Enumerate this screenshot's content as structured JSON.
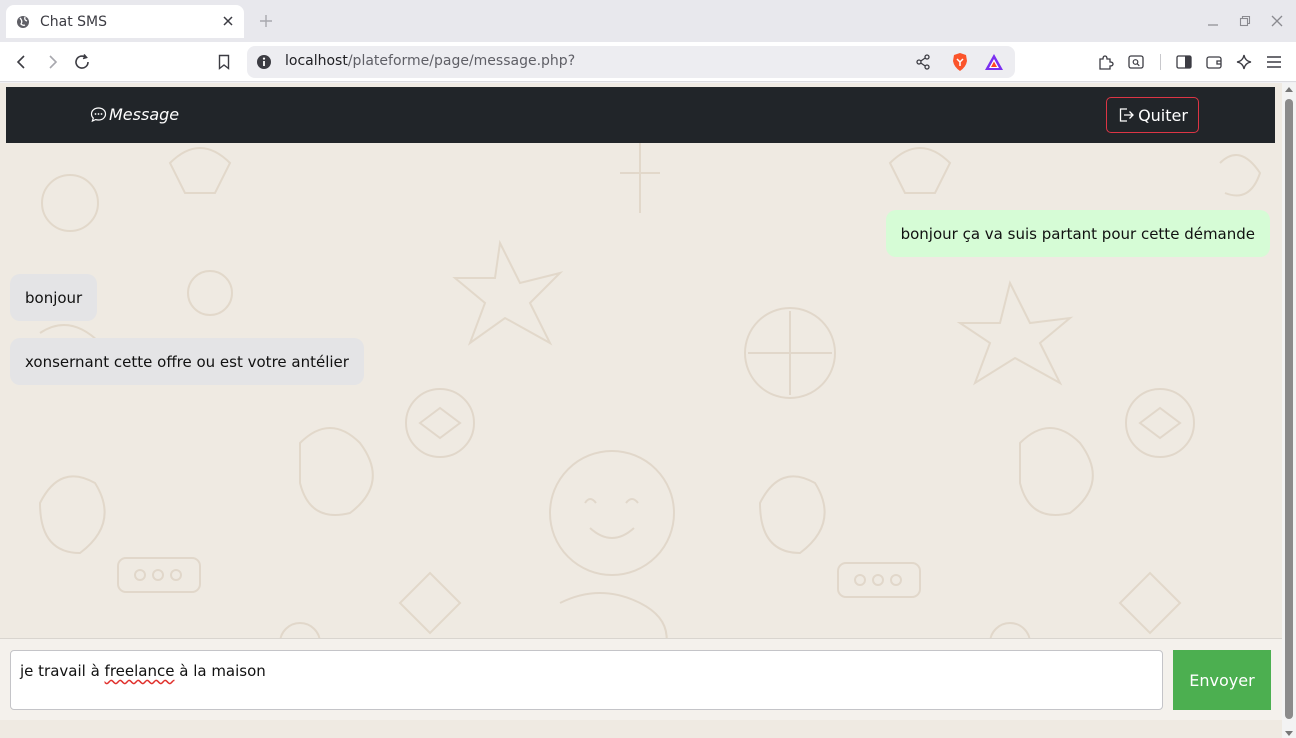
{
  "browser": {
    "tab_title": "Chat SMS",
    "url_host": "localhost",
    "url_path": "/plateforme/page/message.php?"
  },
  "navbar": {
    "brand_label": "Message",
    "quit_label": "Quiter"
  },
  "messages": [
    {
      "direction": "sent",
      "text": "bonjour ça va suis partant pour cette démande"
    },
    {
      "direction": "received",
      "text": "bonjour"
    },
    {
      "direction": "received",
      "text": "xonsernant cette offre ou est votre antélier"
    }
  ],
  "composer": {
    "input_before": "je travail à ",
    "input_misspelled": "freelance",
    "input_after": " à la maison",
    "send_label": "Envoyer"
  },
  "colors": {
    "navbar_bg": "#212529",
    "quit_border": "#dc3545",
    "sent_bubble": "#d6fcd6",
    "received_bubble": "#e4e4e6",
    "send_button": "#4caf50",
    "chat_background": "#efeae2"
  },
  "icons": {
    "tab_favicon": "globe-icon",
    "brand": "chat-bubble-icon",
    "quit": "logout-icon"
  }
}
